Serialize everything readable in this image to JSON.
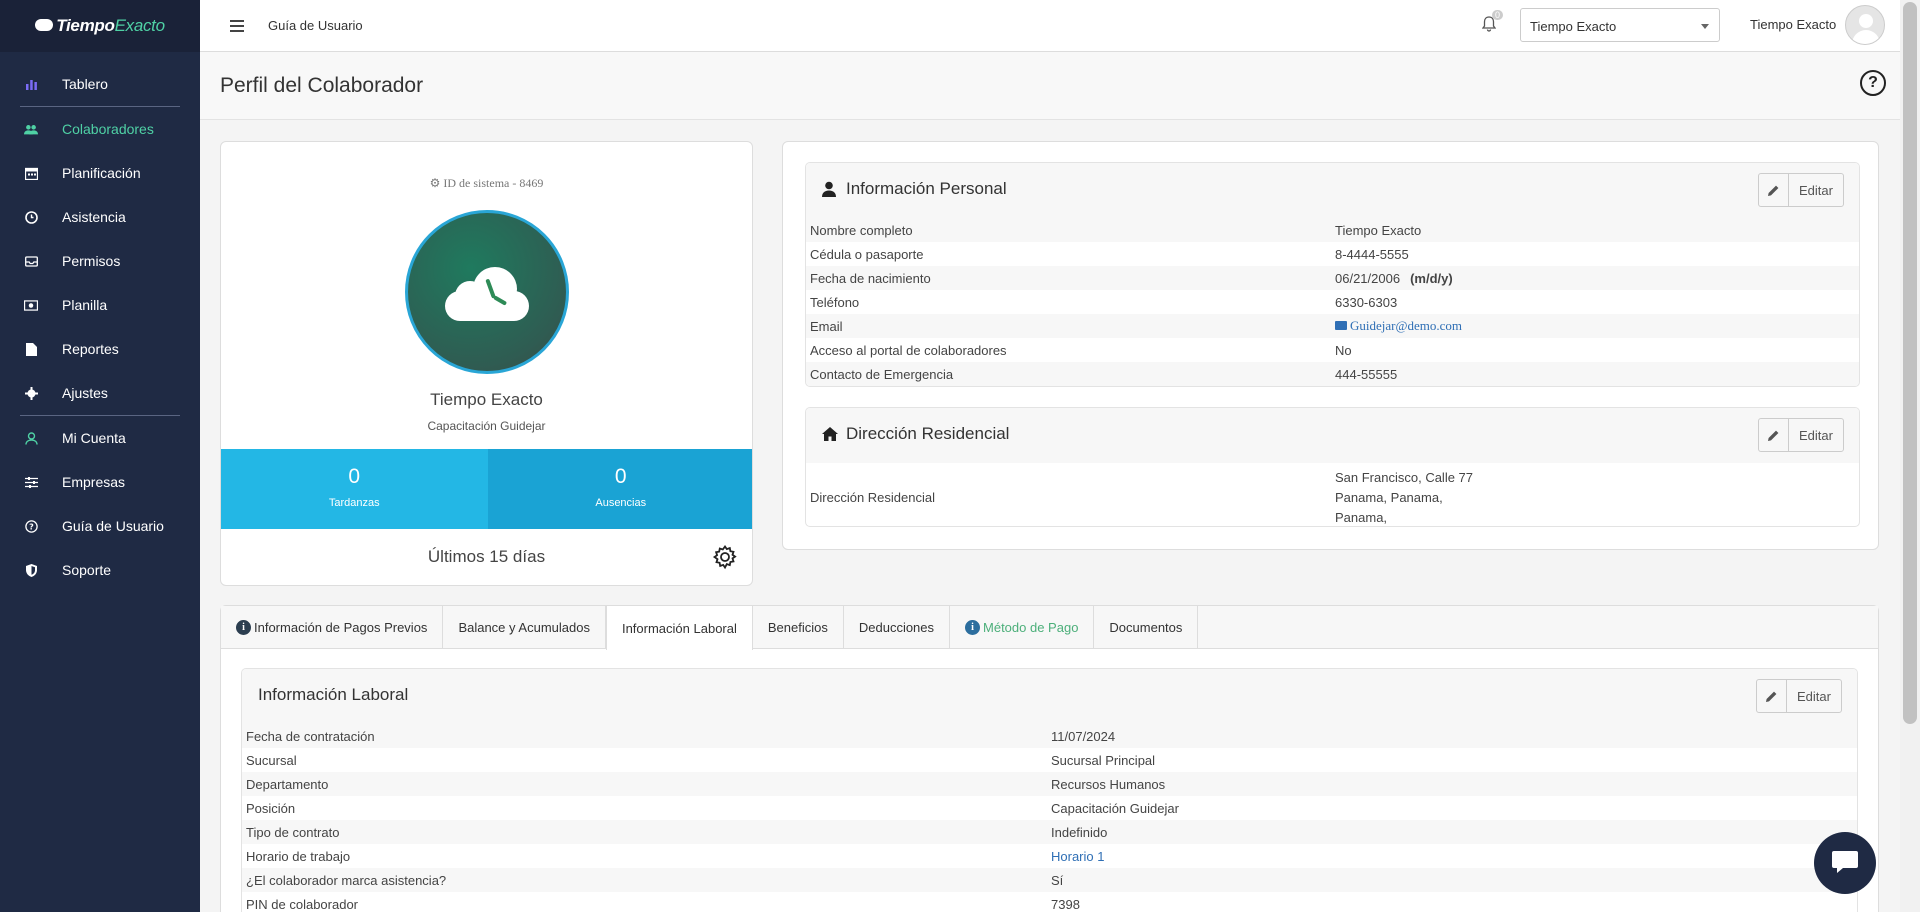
{
  "app": {
    "brand_a": "Tiempo",
    "brand_b": "Exacto"
  },
  "sidebar": {
    "items": [
      {
        "label": "Tablero",
        "icon": "bar-chart-icon"
      },
      {
        "label": "Colaboradores",
        "icon": "users-icon"
      },
      {
        "label": "Planificación",
        "icon": "calendar-icon"
      },
      {
        "label": "Asistencia",
        "icon": "clock-icon"
      },
      {
        "label": "Permisos",
        "icon": "inbox-icon"
      },
      {
        "label": "Planilla",
        "icon": "money-icon"
      },
      {
        "label": "Reportes",
        "icon": "document-icon"
      },
      {
        "label": "Ajustes",
        "icon": "gear-icon"
      },
      {
        "label": "Mi Cuenta",
        "icon": "user-icon"
      },
      {
        "label": "Empresas",
        "icon": "sliders-icon"
      },
      {
        "label": "Guía de Usuario",
        "icon": "question-icon"
      },
      {
        "label": "Soporte",
        "icon": "shield-icon"
      }
    ]
  },
  "topbar": {
    "link": "Guía de Usuario",
    "notifications": "0",
    "company": "Tiempo Exacto",
    "user": "Tiempo Exacto"
  },
  "page": {
    "title": "Perfil del Colaborador"
  },
  "profile": {
    "system_id": "ID de sistema - 8469",
    "name": "Tiempo Exacto",
    "role": "Capacitación Guidejar",
    "tardanzas_value": "0",
    "tardanzas_label": "Tardanzas",
    "ausencias_value": "0",
    "ausencias_label": "Ausencias",
    "period": "Últimos 15 días"
  },
  "personal": {
    "title": "Información Personal",
    "edit": "Editar",
    "rows": [
      {
        "k": "Nombre completo",
        "v": "Tiempo Exacto"
      },
      {
        "k": "Cédula o pasaporte",
        "v": "8-4444-5555"
      },
      {
        "k": "Fecha de nacimiento",
        "v": "06/21/2006",
        "note": "(m/d/y)"
      },
      {
        "k": "Teléfono",
        "v": "6330-6303"
      },
      {
        "k": "Email",
        "v": "Guidejar@demo.com"
      },
      {
        "k": "Acceso al portal de colaboradores",
        "v": "No"
      },
      {
        "k": "Contacto de Emergencia",
        "v": "444-55555"
      }
    ]
  },
  "address": {
    "title": "Dirección Residencial",
    "edit": "Editar",
    "label": "Dirección Residencial",
    "line1": "San Francisco, Calle 77",
    "line2": "Panama, Panama,",
    "line3": "Panama,"
  },
  "tabs": [
    {
      "label": "Información de Pagos Previos"
    },
    {
      "label": "Balance y Acumulados"
    },
    {
      "label": "Información Laboral"
    },
    {
      "label": "Beneficios"
    },
    {
      "label": "Deducciones"
    },
    {
      "label": "Método de Pago"
    },
    {
      "label": "Documentos"
    }
  ],
  "laboral": {
    "title": "Información Laboral",
    "edit": "Editar",
    "rows": [
      {
        "k": "Fecha de contratación",
        "v": "11/07/2024"
      },
      {
        "k": "Sucursal",
        "v": "Sucursal Principal"
      },
      {
        "k": "Departamento",
        "v": "Recursos Humanos"
      },
      {
        "k": "Posición",
        "v": "Capacitación Guidejar"
      },
      {
        "k": "Tipo de contrato",
        "v": "Indefinido"
      },
      {
        "k": "Horario de trabajo",
        "v": "Horario 1"
      },
      {
        "k": "¿El colaborador marca asistencia?",
        "v": "Sí"
      },
      {
        "k": "PIN de colaborador",
        "v": "7398"
      }
    ]
  },
  "colors": {
    "sidebar": "#1f2a44",
    "accent_green": "#4fd1a5",
    "stat_blue": "#23b7e5"
  }
}
